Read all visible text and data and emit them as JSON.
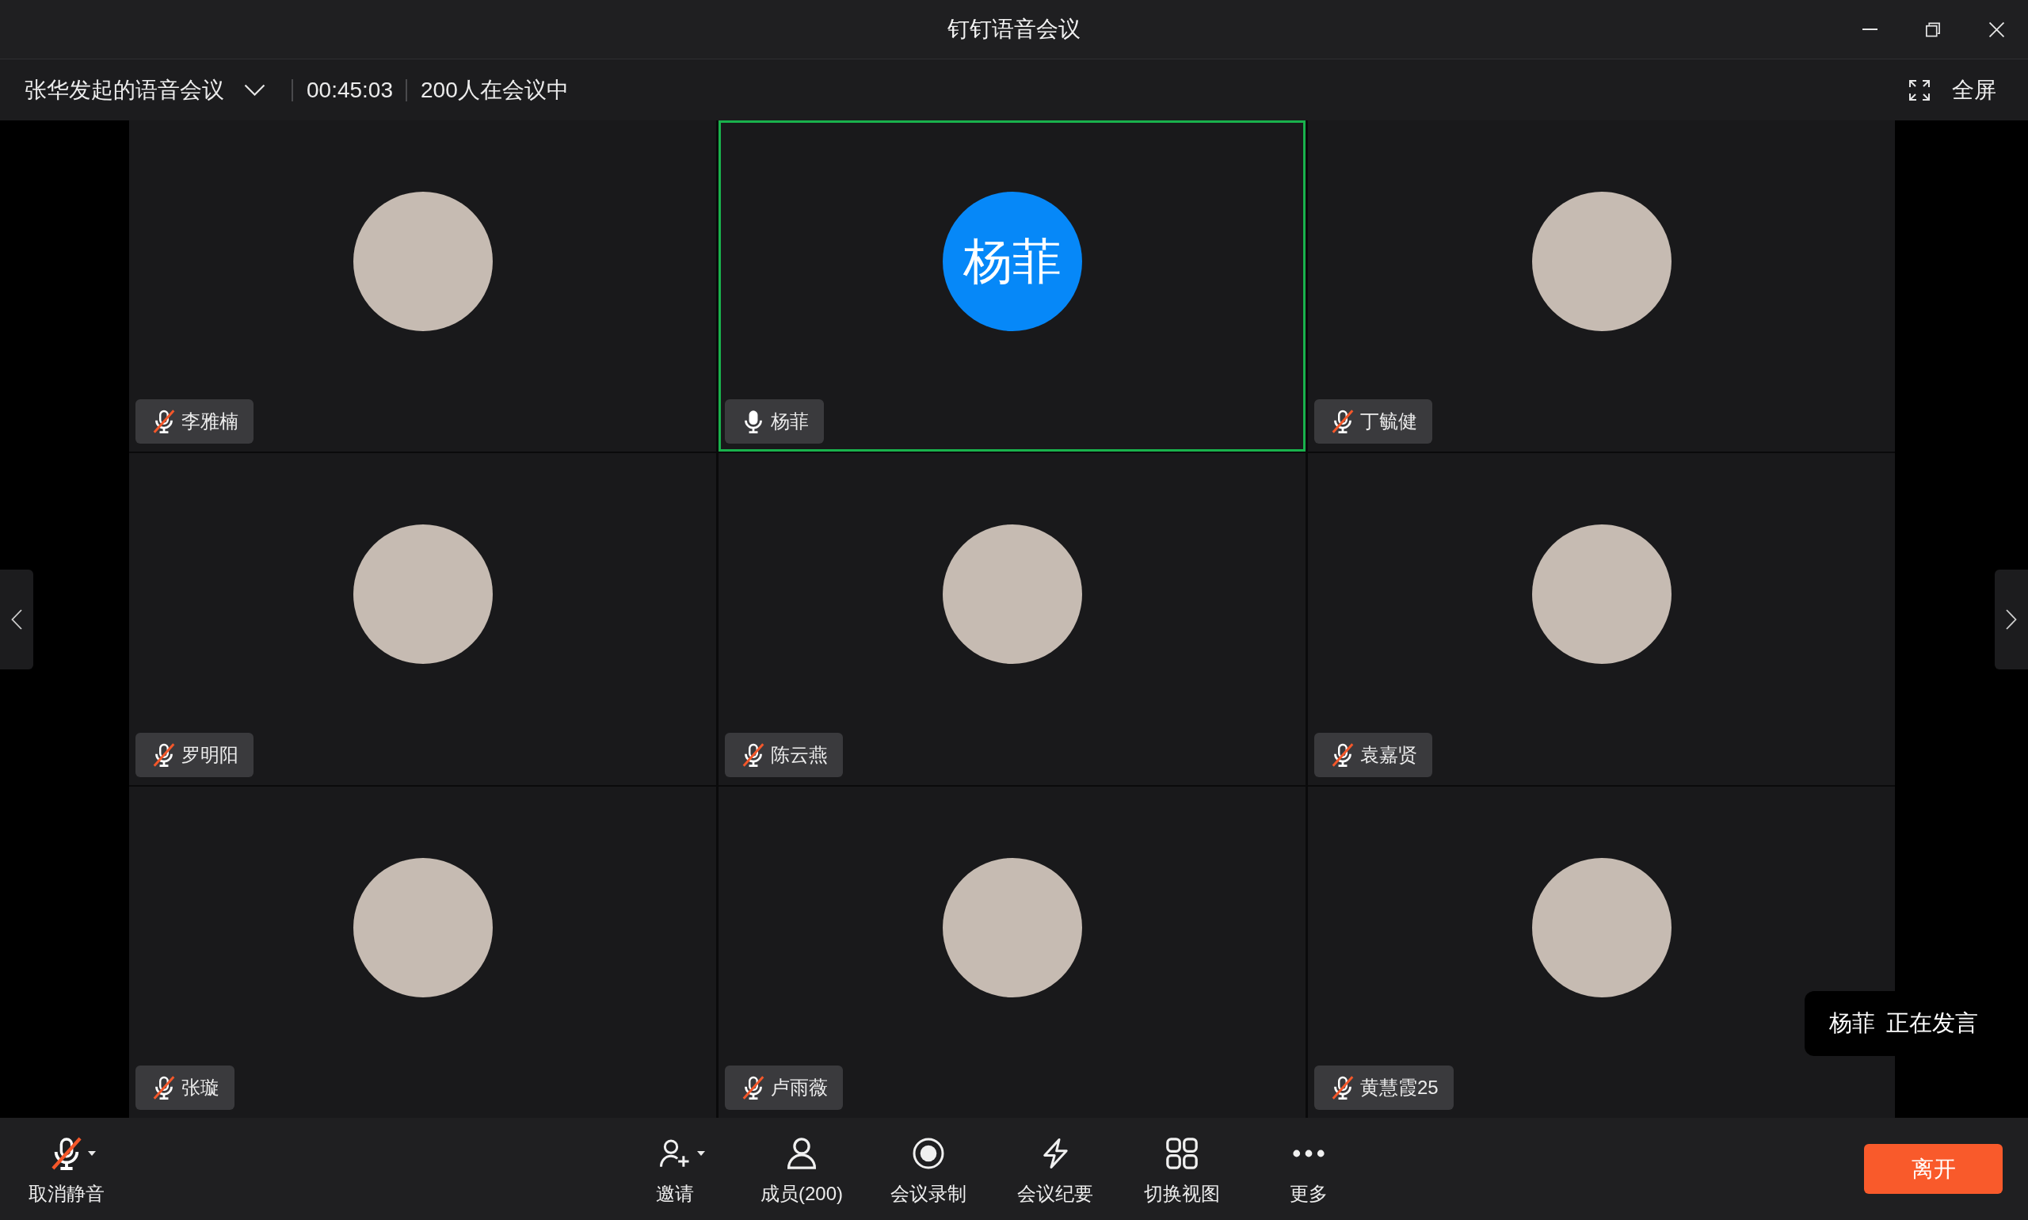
{
  "window": {
    "title": "钉钉语音会议"
  },
  "info_bar": {
    "meeting_title": "张华发起的语音会议",
    "duration": "00:45:03",
    "participants": "200人在会议中",
    "fullscreen": "全屏"
  },
  "tile_rows": [
    {
      "tiles": [
        {
          "name": "李雅楠",
          "muted": true,
          "speaking": false,
          "avatar": {
            "kind": "photo"
          }
        },
        {
          "name": "杨菲",
          "muted": false,
          "speaking": true,
          "avatar": {
            "kind": "initials",
            "text": "杨菲"
          }
        },
        {
          "name": "丁毓健",
          "muted": true,
          "speaking": false,
          "avatar": {
            "kind": "photo"
          }
        }
      ]
    },
    {
      "tiles": [
        {
          "name": "罗明阳",
          "muted": true,
          "speaking": false,
          "avatar": {
            "kind": "photo"
          }
        },
        {
          "name": "陈云燕",
          "muted": true,
          "speaking": false,
          "avatar": {
            "kind": "photo"
          }
        },
        {
          "name": "袁嘉贤",
          "muted": true,
          "speaking": false,
          "avatar": {
            "kind": "photo"
          }
        }
      ]
    },
    {
      "tiles": [
        {
          "name": "张璇",
          "muted": true,
          "speaking": false,
          "avatar": {
            "kind": "photo"
          }
        },
        {
          "name": "卢雨薇",
          "muted": true,
          "speaking": false,
          "avatar": {
            "kind": "photo"
          }
        },
        {
          "name": "黄慧霞25",
          "muted": true,
          "speaking": false,
          "avatar": {
            "kind": "photo"
          }
        }
      ]
    }
  ],
  "speaking_notice": "杨菲 正在发言",
  "toolbar": {
    "mic": {
      "label": "取消静音",
      "muted": true,
      "dropdown": true
    },
    "actions": [
      {
        "kind": "invite",
        "label": "邀请",
        "dropdown": true
      },
      {
        "kind": "members",
        "label": "成员(200)",
        "dropdown": false
      },
      {
        "kind": "record",
        "label": "会议录制",
        "dropdown": false
      },
      {
        "kind": "minutes",
        "label": "会议纪要",
        "dropdown": false
      },
      {
        "kind": "layout",
        "label": "切换视图",
        "dropdown": false
      },
      {
        "kind": "more",
        "label": "更多",
        "dropdown": false
      }
    ],
    "leave": "离开"
  }
}
